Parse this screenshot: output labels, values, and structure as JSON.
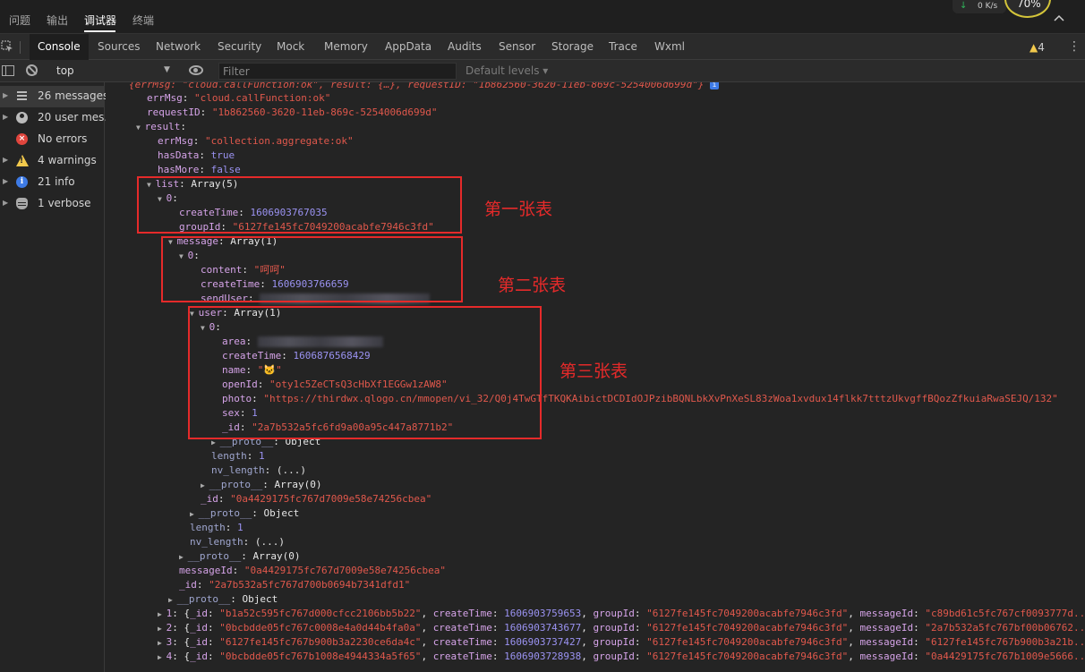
{
  "top_tabs": [
    "问题",
    "输出",
    "调试器",
    "终端"
  ],
  "active_top_tab": "调试器",
  "net_speed": "0 K/s",
  "cpu_percent": "70%",
  "panel_tabs": [
    "Console",
    "Sources",
    "Network",
    "Security",
    "Mock",
    "Memory",
    "AppData",
    "Audits",
    "Sensor",
    "Storage",
    "Trace",
    "Wxml"
  ],
  "active_panel_tab": "Console",
  "warning_badge": "4",
  "toolbar": {
    "context": "top",
    "filter_placeholder": "Filter",
    "levels": "Default levels ▾"
  },
  "sidebar": [
    {
      "label": "26 messages",
      "icon": "list-icon"
    },
    {
      "label": "20 user mes...",
      "icon": "user-icon"
    },
    {
      "label": "No errors",
      "icon": "error-icon"
    },
    {
      "label": "4 warnings",
      "icon": "warning-icon"
    },
    {
      "label": "21 info",
      "icon": "info-icon"
    },
    {
      "label": "1 verbose",
      "icon": "bug-icon"
    }
  ],
  "console": {
    "first_line": "{errMsg: \"cloud.callFunction:ok\", result: {…}, requestID: \"1b862560-3620-11eb-869c-5254006d699d\"}",
    "errMsg_key": "errMsg",
    "errMsg_val": "\"cloud.callFunction:ok\"",
    "requestID_key": "requestID",
    "requestID_val": "\"1b862560-3620-11eb-869c-5254006d699d\"",
    "result_key": "result",
    "result_errMsg_val": "\"collection.aggregate:ok\"",
    "hasData_key": "hasData",
    "hasData_val": "true",
    "hasMore_key": "hasMore",
    "hasMore_val": "false",
    "list_key": "list",
    "list_summary": "Array(5)",
    "idx0": "0",
    "createTime_key": "createTime",
    "list0_createTime": "1606903767035",
    "groupId_key": "groupId",
    "list0_groupId": "\"6127fe145fc7049200acabfe7946c3fd\"",
    "message_key": "message",
    "message_summary": "Array(1)",
    "content_key": "content",
    "msg0_content": "\"呵呵\"",
    "msg0_createTime": "1606903766659",
    "sendUser_key": "sendUser",
    "user_key": "user",
    "user_summary": "Array(1)",
    "area_key": "area",
    "user0_createTime": "1606876568429",
    "name_key": "name",
    "user0_name": "\"🐱\"",
    "openId_key": "openId",
    "user0_openId": "\"oty1c5ZeCTsQ3cHbXf1EGGw1zAW8\"",
    "photo_key": "photo",
    "user0_photo": "\"https://thirdwx.qlogo.cn/mmopen/vi_32/Q0j4TwGTfTKQKAibictDCDIdOJPzibBQNLbkXvPnXeSL83zWoa1xvdux14flkk7tttzUkvgffBQozZfkuiaRwaSEJQ/132\"",
    "sex_key": "sex",
    "user0_sex": "1",
    "id_key": "_id",
    "user0_id": "\"2a7b532a5fc6fd9a00a95c447a8771b2\"",
    "proto_key": "__proto__",
    "object_word": "Object",
    "length_key": "length",
    "one": "1",
    "nv_length_key": "nv_length",
    "ellipsis": "(...)",
    "array0": "Array(0)",
    "msg0_id": "\"0a4429175fc767d7009e58e74256cbea\"",
    "messageId_key": "messageId",
    "list0_messageId": "\"0a4429175fc767d7009e58e74256cbea\"",
    "list0_id": "\"2a7b532a5fc767d700b0694b7341dfd1\"",
    "rows": [
      {
        "idx": "1",
        "id": "\"b1a52c595fc767d000cfcc2106bb5b22\"",
        "ct": "1606903759653",
        "gid": "\"6127fe145fc7049200acabfe7946c3fd\"",
        "mid": "\"c89bd61c5fc767cf0093777d..."
      },
      {
        "idx": "2",
        "id": "\"0bcbdde05fc767c0008e4a0d44b4fa0a\"",
        "ct": "1606903743677",
        "gid": "\"6127fe145fc7049200acabfe7946c3fd\"",
        "mid": "\"2a7b532a5fc767bf00b06762..."
      },
      {
        "idx": "3",
        "id": "\"6127fe145fc767b900b3a2230ce6da4c\"",
        "ct": "1606903737427",
        "gid": "\"6127fe145fc7049200acabfe7946c3fd\"",
        "mid": "\"6127fe145fc767b900b3a21b..."
      },
      {
        "idx": "4",
        "id": "\"0bcbdde05fc767b1008e4944334a5f65\"",
        "ct": "1606903728938",
        "gid": "\"6127fe145fc7049200acabfe7946c3fd\"",
        "mid": "\"0a4429175fc767b1009e5666..."
      }
    ]
  },
  "annotations": {
    "table1": "第一张表",
    "table2": "第二张表",
    "table3": "第三张表"
  },
  "colors": {
    "annotation": "#e52a2a",
    "string": "#e0584c",
    "number": "#9b93f2",
    "key": "#9fa6cf"
  }
}
